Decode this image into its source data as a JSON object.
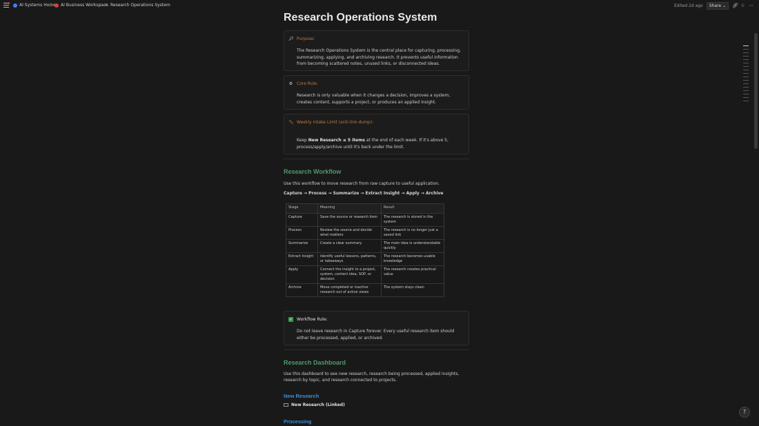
{
  "topbar": {
    "crumbs": [
      {
        "label": "AI Systems Home",
        "icon": "blue-globe-icon",
        "color": "#3b82f6"
      },
      {
        "label": "AI Business Workspace",
        "icon": "red-record-icon",
        "color": "#e53935"
      },
      {
        "label": "Research Operations System",
        "icon": "magnifier-icon",
        "color": "#bbbbbb"
      }
    ],
    "edited": "Edited 2d ago",
    "share_label": "Share"
  },
  "page": {
    "title": "Research Operations System",
    "callouts": {
      "purpose": {
        "icon": "magnifier-icon",
        "label": "Purpose:",
        "body": "The Research Operations System is the central place for capturing, processing, summarizing, applying, and archiving research. It prevents useful information from becoming scattered notes, unused links, or disconnected ideas."
      },
      "core_rule": {
        "icon": "gear-icon",
        "label": "Core Rule:",
        "body": "Research is only valuable when it changes a decision, improves a system, creates content, supports a project, or produces an applied insight."
      },
      "weekly": {
        "icon": "ruler-icon",
        "label": "Weekly Intake Limit (anti-link-dump):",
        "body_prefix": "Keep ",
        "body_bold": "New Research ≤ 5 items",
        "body_suffix": " at the end of each week. If it's above 5, process/apply/archive until it's back under the limit."
      },
      "workflow_rule": {
        "icon": "check-box-icon",
        "label": "Workflow Rule:",
        "body": "Do not leave research in Capture forever. Every useful research item should either be processed, applied, or archived."
      }
    },
    "workflow": {
      "heading": "Research Workflow",
      "intro": "Use this workflow to move research from raw capture to useful application.",
      "flow": "Capture → Process → Summarize → Extract Insight → Apply → Archive",
      "table": {
        "headers": [
          "Stage",
          "Meaning",
          "Result"
        ],
        "rows": [
          [
            "Capture",
            "Save the source or research item",
            "The research is stored in the system"
          ],
          [
            "Process",
            "Review the source and decide what matters",
            "The research is no longer just a saved link"
          ],
          [
            "Summarize",
            "Create a clear summary",
            "The main idea is understandable quickly"
          ],
          [
            "Extract Insight",
            "Identify useful lessons, patterns, or takeaways",
            "The research becomes usable knowledge"
          ],
          [
            "Apply",
            "Connect the insight to a project, system, content idea, SOP, or decision",
            "The research creates practical value"
          ],
          [
            "Archive",
            "Move completed or inactive research out of active views",
            "The system stays clean"
          ]
        ]
      }
    },
    "dashboard": {
      "heading": "Research Dashboard",
      "intro": "Use this dashboard to see new research, research being processed, applied insights, research by topic, and research connected to projects.",
      "new_research": "New Research",
      "linked_view": "New Research (Linked)",
      "processing": "Processing"
    }
  },
  "colors": {
    "background": "#191919",
    "green_heading": "#4f9a6a",
    "blue_heading": "#3f8fd6",
    "orange_label": "#c47a3d"
  }
}
